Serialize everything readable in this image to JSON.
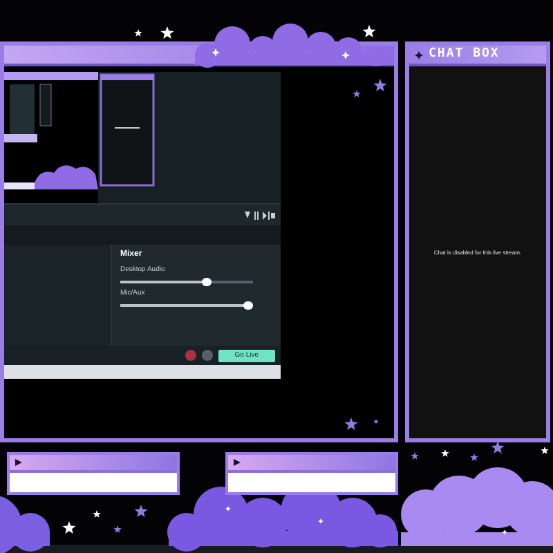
{
  "main_frame": {
    "screen_capture": {
      "mixer": {
        "title": "Mixer",
        "channels": [
          {
            "name": "Desktop Audio",
            "level": 0.65
          },
          {
            "name": "Mic/Aux",
            "level": 0.96
          }
        ]
      },
      "go_live_button": "Go Live"
    }
  },
  "chat_box": {
    "title": "CHAT BOX",
    "message": "Chat is disabled for this live stream."
  },
  "bottom_panels": [
    {
      "kind": "label-box"
    },
    {
      "kind": "label-box"
    }
  ]
}
